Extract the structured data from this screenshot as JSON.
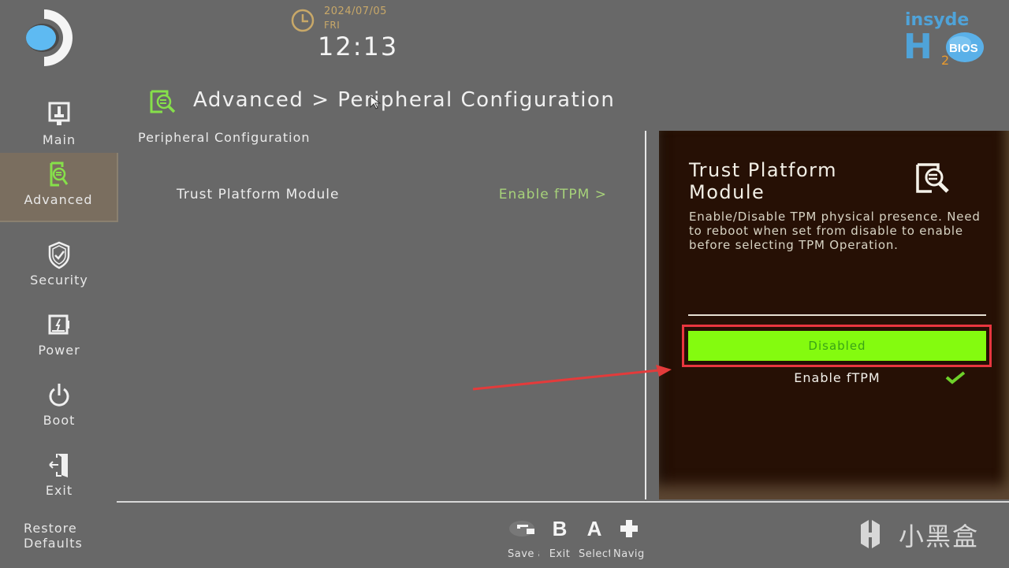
{
  "header": {
    "date": "2024/07/05",
    "day": "FRI",
    "time": "12:13",
    "brand_logo": "insyde-h2o-bios-logo",
    "brand_text_top": "insyde",
    "brand_text_h": "H",
    "brand_text_sub": "2",
    "brand_text_bios": "BIOS"
  },
  "sidebar": {
    "items": [
      {
        "label": "Main",
        "icon": "monitor-icon",
        "active": false
      },
      {
        "label": "Advanced",
        "icon": "document-search-icon",
        "active": true
      },
      {
        "label": "Security",
        "icon": "shield-check-icon",
        "active": false
      },
      {
        "label": "Power",
        "icon": "battery-bolt-icon",
        "active": false
      },
      {
        "label": "Boot",
        "icon": "power-icon",
        "active": false
      },
      {
        "label": "Exit",
        "icon": "door-exit-icon",
        "active": false
      }
    ],
    "restore_defaults": [
      "Restore",
      "Defaults"
    ]
  },
  "breadcrumb": {
    "path": "Advanced > Peripheral Configuration",
    "parts": [
      "Advanced",
      ">",
      "Peripheral Configuration"
    ]
  },
  "main": {
    "section_title": "Peripheral Configuration",
    "settings": [
      {
        "label": "Trust Platform Module",
        "value": "Enable fTPM >"
      }
    ]
  },
  "help_panel": {
    "title_line1": "Trust Platform",
    "title_line2": "Module",
    "description": "Enable/Disable TPM physical presence. Need to reboot when set from disable to enable before selecting TPM Operation.",
    "options": [
      {
        "label": "Disabled",
        "highlighted": true,
        "checked": false
      },
      {
        "label": "Enable fTPM",
        "highlighted": false,
        "checked": true
      }
    ]
  },
  "hints": [
    {
      "key": "toggle-icon",
      "label": "Save and"
    },
    {
      "key": "B",
      "label": "Exit"
    },
    {
      "key": "A",
      "label": "Select"
    },
    {
      "key": "dpad-icon",
      "label": "Navigation"
    }
  ],
  "watermark": {
    "text": "小黑盒"
  },
  "colors": {
    "accent_green": "#84fb0f",
    "value_green": "#a7d27a",
    "annotation_red": "#e8363f",
    "panel_bg": "#261005",
    "date_gold": "#c8a868"
  }
}
